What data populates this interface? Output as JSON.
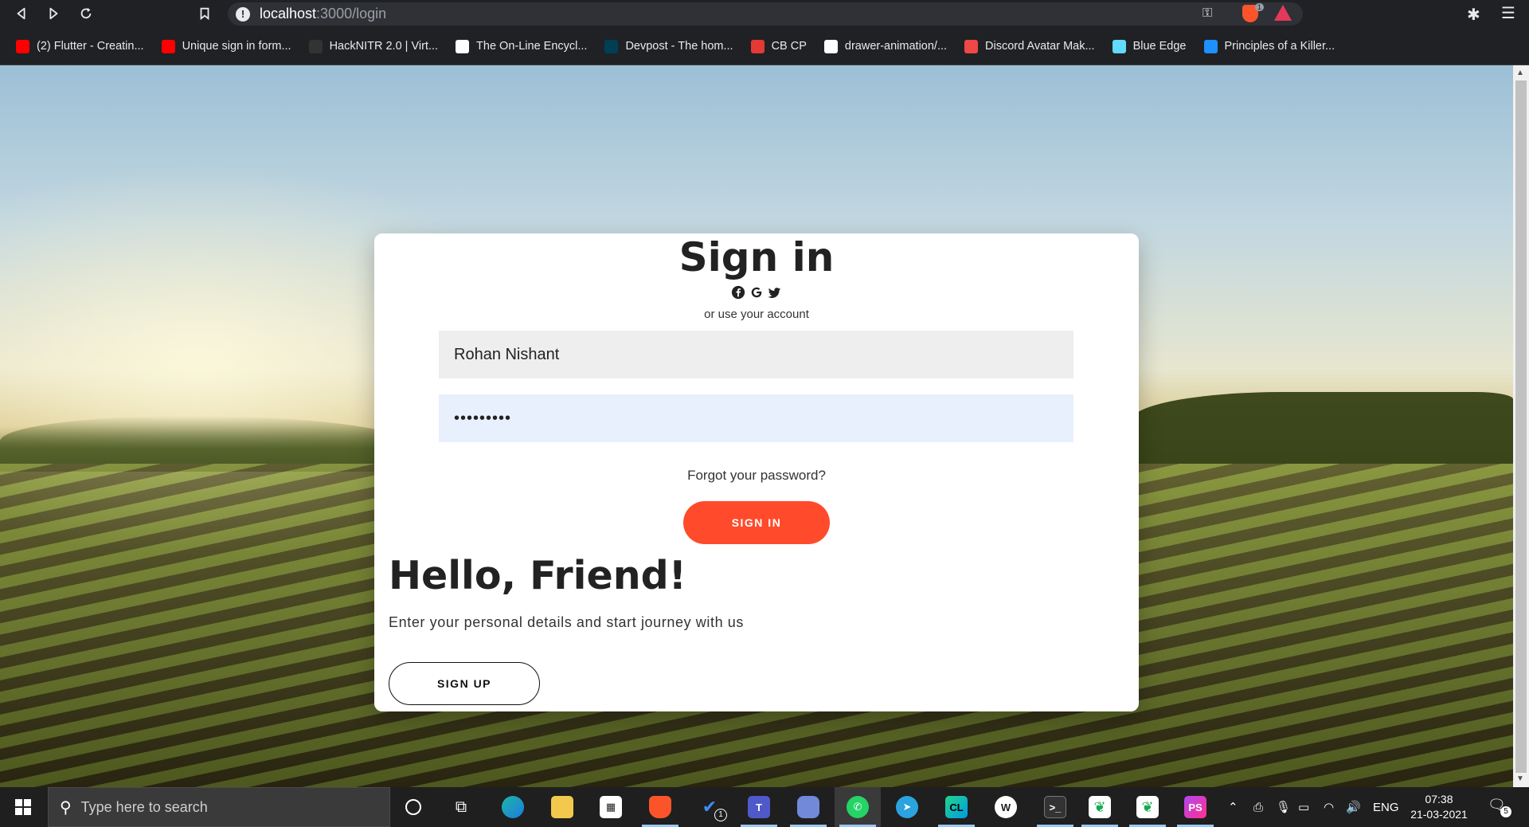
{
  "browser": {
    "url_host": "localhost",
    "url_path": ":3000/login",
    "brave_badge": "1"
  },
  "bookmarks": [
    {
      "label": "(2) Flutter - Creatin...",
      "icon": "youtube-icon",
      "color": "#ff0000"
    },
    {
      "label": "Unique sign in form...",
      "icon": "youtube-icon",
      "color": "#ff0000"
    },
    {
      "label": "HackNITR 2.0 | Virt...",
      "icon": "hacknitr-icon",
      "color": "#333333"
    },
    {
      "label": "The On-Line Encycl...",
      "icon": "oeis-icon",
      "color": "#ffffff"
    },
    {
      "label": "Devpost - The hom...",
      "icon": "devpost-icon",
      "color": "#003e54"
    },
    {
      "label": "CB CP",
      "icon": "codeblocks-icon",
      "color": "#e53935"
    },
    {
      "label": "drawer-animation/...",
      "icon": "github-icon",
      "color": "#ffffff"
    },
    {
      "label": "Discord Avatar Mak...",
      "icon": "discord-icon",
      "color": "#f04747"
    },
    {
      "label": "Blue Edge",
      "icon": "react-icon",
      "color": "#61dafb"
    },
    {
      "label": "Principles of a Killer...",
      "icon": "puzzle-icon",
      "color": "#1e90ff"
    }
  ],
  "login": {
    "title": "Sign in",
    "or_text": "or use your account",
    "name_value": "Rohan Nishant",
    "password_value": "•••••••••",
    "forgot": "Forgot your password?",
    "signin_button": "SIGN IN",
    "hello": "Hello, Friend!",
    "journey": "Enter your personal details and start journey with us",
    "signup_button": "SIGN UP",
    "accent": "#ff4b2b"
  },
  "taskbar": {
    "search_placeholder": "Type here to search",
    "todo_badge": "1",
    "language": "ENG",
    "time": "07:38",
    "date": "21-03-2021",
    "notification_count": "5"
  }
}
